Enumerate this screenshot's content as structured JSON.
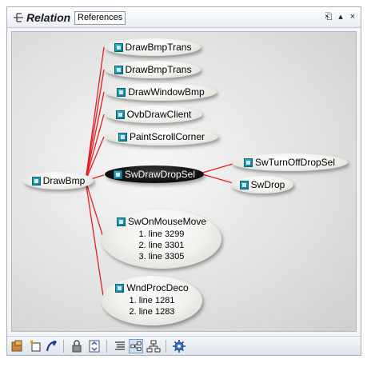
{
  "header": {
    "title": "Relation",
    "tab_label": "References",
    "controls": [
      "pin-icon",
      "dock-icon",
      "close-icon"
    ],
    "control_glyphs": {
      "pin": "⎗",
      "dock": "▴",
      "close": "×"
    }
  },
  "graph": {
    "root": {
      "label": "DrawBmp"
    },
    "children": [
      {
        "label": "DrawBmpTrans"
      },
      {
        "label": "DrawBmpTrans"
      },
      {
        "label": "DrawWindowBmp"
      },
      {
        "label": "OvbDrawClient"
      },
      {
        "label": "PaintScrollCorner"
      },
      {
        "label": "SwDrawDropSel",
        "selected": true
      },
      {
        "label": "SwOnMouseMove",
        "lines": [
          "1. line 3299",
          "2. line 3301",
          "3. line 3305"
        ]
      },
      {
        "label": "WndProcDeco",
        "lines": [
          "1. line 1281",
          "2. line 1283"
        ]
      }
    ],
    "grandchildren": [
      {
        "label": "SwTurnOffDropSel"
      },
      {
        "label": "SwDrop"
      }
    ],
    "edge_color": "#e02020"
  },
  "toolbar": {
    "icons": [
      "export-icon",
      "new-window-icon",
      "refresh-icon",
      "lock-icon",
      "sync-icon",
      "list-view-icon",
      "graph-view-icon",
      "tree-view-icon",
      "settings-icon"
    ]
  }
}
